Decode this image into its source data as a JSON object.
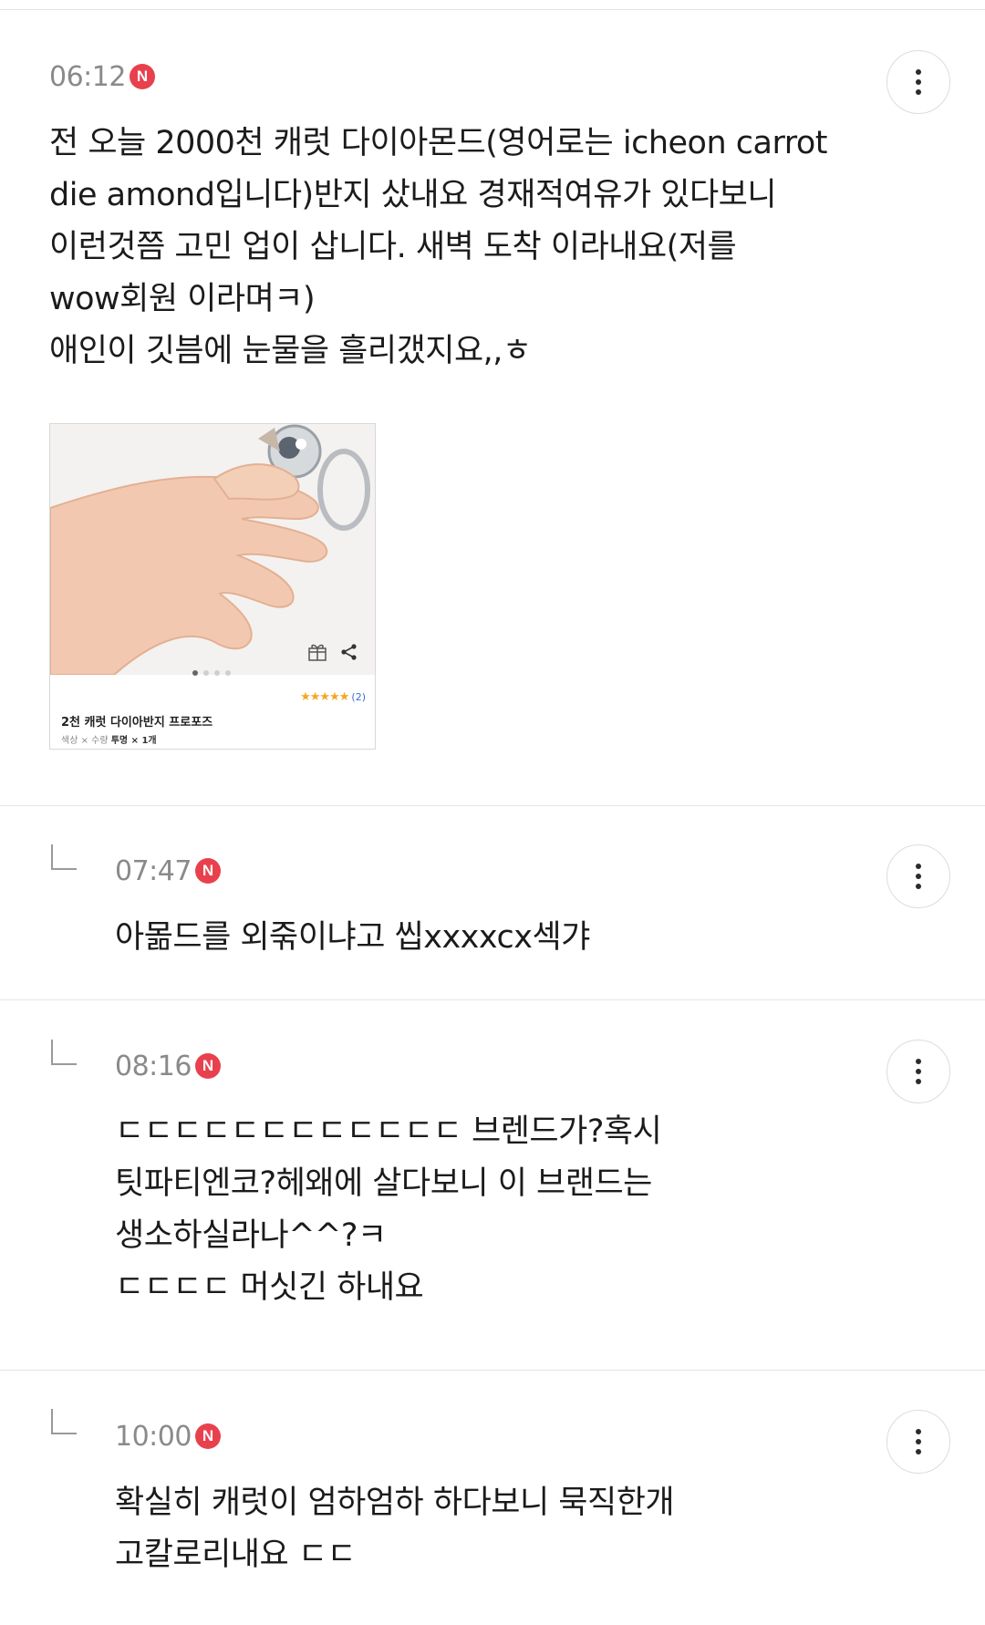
{
  "comments": [
    {
      "time": "06:12",
      "badge": "N",
      "text": "전 오늘 2000천 캐럿 다이아몬드(영어로는 icheon carrot\ndie amond입니다)반지 샀내요 경재적여유가 있다보니\n이런것쯤 고민 업이 삽니다. 새벽 도착 이라내요(저를\nwow회원 이라며ㅋ)\n애인이 깃븜에 눈물을 흘리갰지요,,ㅎ",
      "product": {
        "title": "2천 캐럿 다이아반지 프로포즈",
        "option_prefix": "색상 × 수량",
        "option_value": "투명 × 1개",
        "rating_count": "(2)",
        "stars": "★★★★★"
      }
    },
    {
      "time": "07:47",
      "badge": "N",
      "text": "아몲드를 외죾이냐고 씹xxxxcx섹갸"
    },
    {
      "time": "08:16",
      "badge": "N",
      "text": "ㄷㄷㄷㄷㄷㄷㄷㄷㄷㄷㄷㄷ 브렌드가?혹시\n팃파티엔코?헤왜에 살다보니 이 브랜드는\n생소하실라나^^?ㅋ\nㄷㄷㄷㄷ 머싯긴 하내요"
    },
    {
      "time": "10:00",
      "badge": "N",
      "text": "확실히 캐럿이 엄하엄하 하다보니 묵직한개\n고칼로리내요 ㄷㄷ"
    }
  ],
  "colors": {
    "badge": "#e8414d",
    "time": "#8a8a8a",
    "divider": "#e4e4e4"
  },
  "icons": {
    "more": "more-vertical-icon",
    "reply": "reply-arrow-icon",
    "gift": "gift-icon",
    "share": "share-icon"
  }
}
